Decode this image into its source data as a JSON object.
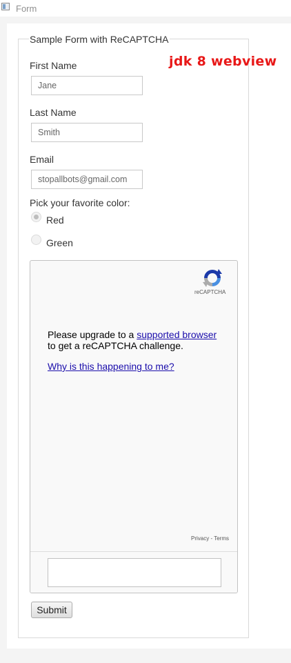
{
  "window": {
    "title": "Form",
    "icon": "window-icon"
  },
  "annotation": {
    "text": "jdk 8 webview",
    "color": "#e81818"
  },
  "form": {
    "legend": "Sample Form with ReCAPTCHA",
    "first_name": {
      "label": "First Name",
      "value": "Jane"
    },
    "last_name": {
      "label": "Last Name",
      "value": "Smith"
    },
    "email": {
      "label": "Email",
      "value": "stopallbots@gmail.com"
    },
    "color_question": "Pick your favorite color:",
    "color_options": [
      {
        "label": "Red",
        "checked": true
      },
      {
        "label": "Green",
        "checked": false
      }
    ],
    "submit_label": "Submit"
  },
  "recaptcha": {
    "brand": "reCAPTCHA",
    "logo_icon": "recaptcha-logo-icon",
    "message_before": "Please upgrade to a ",
    "message_link": "supported browser",
    "message_after": "to get a reCAPTCHA challenge.",
    "why_link": "Why is this happening to me?",
    "privacy": "Privacy",
    "separator": " - ",
    "terms": "Terms",
    "link_color": "#1a0dab"
  }
}
